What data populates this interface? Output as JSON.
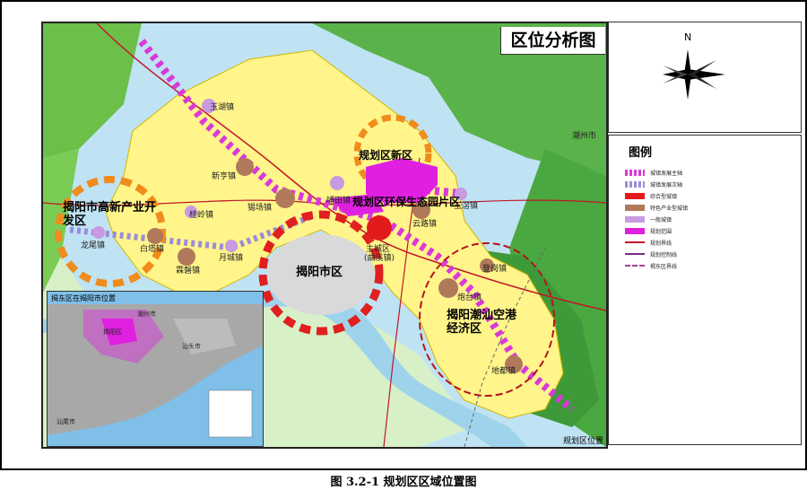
{
  "map_title": "区位分析图",
  "zones": {
    "new_district": "规划区新区",
    "eco_park": "规划区环保生态园片区",
    "gaoxin": "揭阳市高新产业开发区",
    "city": "揭阳市区",
    "airport": "揭阳潮汕空港经济区"
  },
  "towns": [
    "玉湖镇",
    "新亨镇",
    "锡场镇",
    "桂岭镇",
    "白塔镇",
    "龙尾镇",
    "霖磐镇",
    "月城镇",
    "埔田镇",
    "云路镇",
    "玉滘镇",
    "登岗镇",
    "炮台镇",
    "地都镇"
  ],
  "special_labels": {
    "main_city": "主城区",
    "main_city_sub": "(曲溪镇)",
    "chaozhou": "潮州市"
  },
  "compass_label": "N",
  "legend": {
    "title": "图例",
    "items": [
      {
        "label": "城镇发展主轴",
        "color": "#d83ad8",
        "style": "dash-main"
      },
      {
        "label": "城镇发展次轴",
        "color": "#9b8cd8",
        "style": "dash-sub"
      },
      {
        "label": "综合型城镇",
        "color": "#e31a1c",
        "style": "box"
      },
      {
        "label": "特色产业型城镇",
        "color": "#b07a5a",
        "style": "box"
      },
      {
        "label": "一般城镇",
        "color": "#c89ae0",
        "style": "box"
      },
      {
        "label": "规划范围",
        "color": "#e020e0",
        "style": "box"
      },
      {
        "label": "规划界线",
        "color": "#c0172a",
        "style": "line"
      },
      {
        "label": "规划控制线",
        "color": "#7a2a8a",
        "style": "line"
      },
      {
        "label": "揭东区界线",
        "color": "#a040a0",
        "style": "dashline"
      }
    ]
  },
  "inset": {
    "title": "揭东区在揭阳市位置",
    "labels": [
      "潮州市",
      "揭阳区",
      "汕头市",
      "汕尾市"
    ]
  },
  "corner_label": "规划区位置",
  "caption": "图 3.2-1  规划区区域位置图"
}
